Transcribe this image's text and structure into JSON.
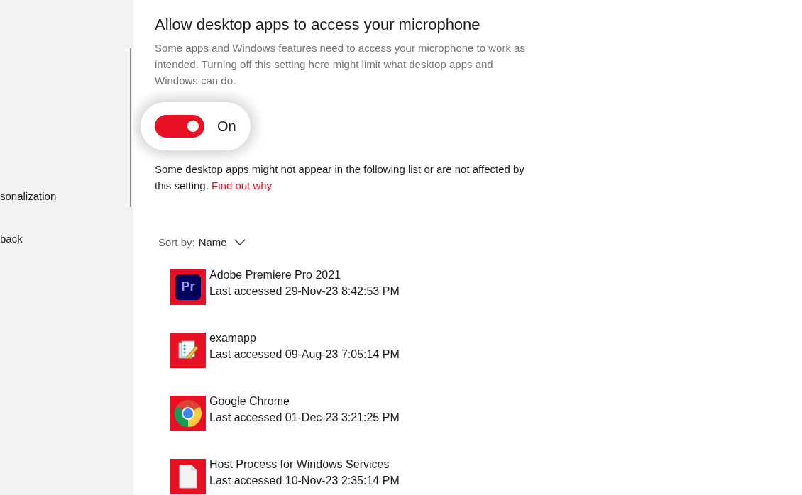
{
  "sidebar": {
    "items": [
      {
        "label": "sonalization"
      },
      {
        "label": "back"
      }
    ]
  },
  "section": {
    "title": "Allow desktop apps to access your microphone",
    "description": "Some apps and Windows features need to access your microphone to work as intended. Turning off this setting here might limit what desktop apps and Windows can do.",
    "toggle": {
      "on": true,
      "label": "On",
      "highlighted": true
    },
    "note": "Some desktop apps might not appear in the following list or are not affected by this setting.",
    "note_link": "Find out why"
  },
  "sort": {
    "label": "Sort by:",
    "value": "Name"
  },
  "apps": [
    {
      "kind": "premiere",
      "name": "Adobe Premiere Pro 2021",
      "accessed": "Last accessed 29-Nov-23 8:42:53 PM",
      "icon_text": "Pr"
    },
    {
      "kind": "exam",
      "name": "examapp",
      "accessed": "Last accessed 09-Aug-23 7:05:14 PM"
    },
    {
      "kind": "chrome",
      "name": "Google Chrome",
      "accessed": "Last accessed 01-Dec-23 3:21:25 PM"
    },
    {
      "kind": "file",
      "name": "Host Process for Windows Services",
      "accessed": "Last accessed 10-Nov-23 2:35:14 PM"
    }
  ]
}
